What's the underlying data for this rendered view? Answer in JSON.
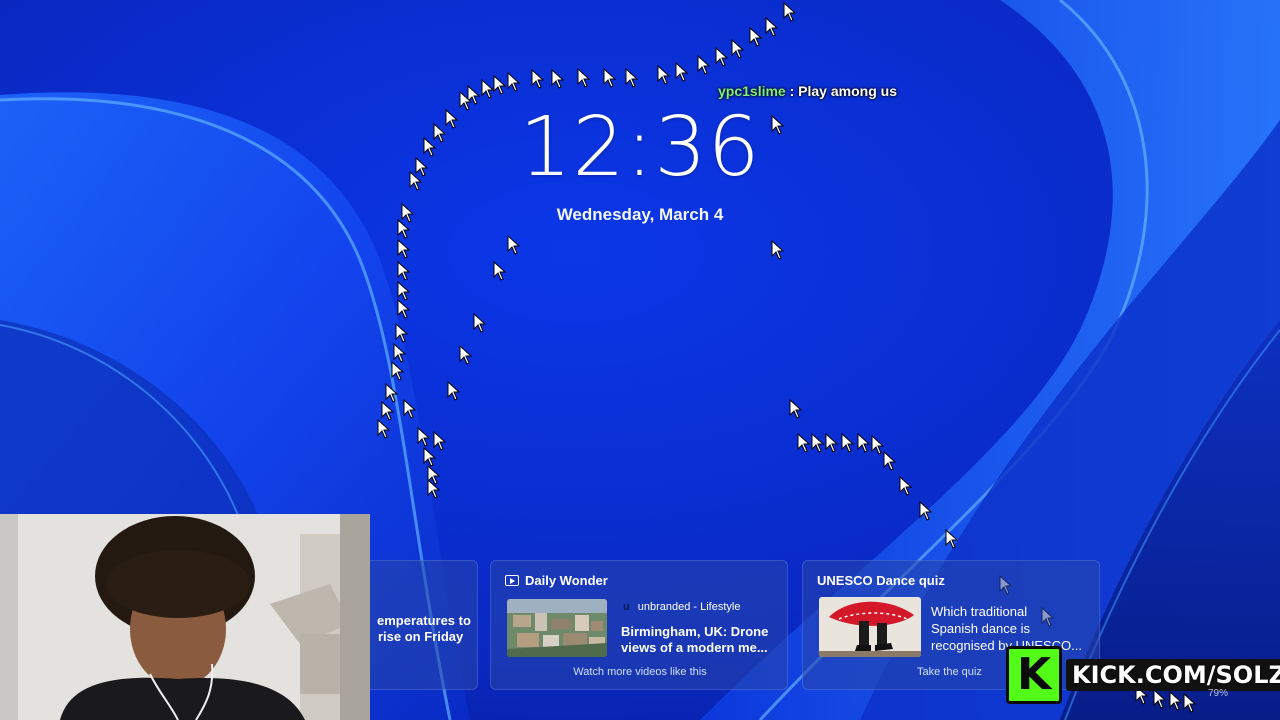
{
  "colors": {
    "wallpaper_base": "#0a2fd6",
    "chat_username": "#7ef07e",
    "kick_brand": "#53fc18"
  },
  "lockscreen": {
    "time": "12:36",
    "date": "Wednesday, March 4"
  },
  "chat": {
    "username": "ypc1slime",
    "separator": " : ",
    "message": "Play among us"
  },
  "widgets": {
    "weather_card": {
      "line1": "emperatures to",
      "line2": "rise on Friday"
    },
    "daily_wonder": {
      "title": "Daily Wonder",
      "source_initial": "u",
      "source": "unbranded - Lifestyle",
      "headline_1": "Birmingham, UK: Drone",
      "headline_2": "views of a modern me...",
      "link": "Watch more videos like this",
      "icon": "video-icon"
    },
    "unesco_quiz": {
      "title": "UNESCO Dance quiz",
      "question_1": "Which traditional",
      "question_2": "Spanish dance is",
      "question_3": "recognised by UNESCO...",
      "link": "Take the quiz"
    }
  },
  "overlay": {
    "kick_logo_letter": "K",
    "kick_url": "KICK.COM/SOLZ"
  },
  "status": {
    "battery": "79%"
  }
}
